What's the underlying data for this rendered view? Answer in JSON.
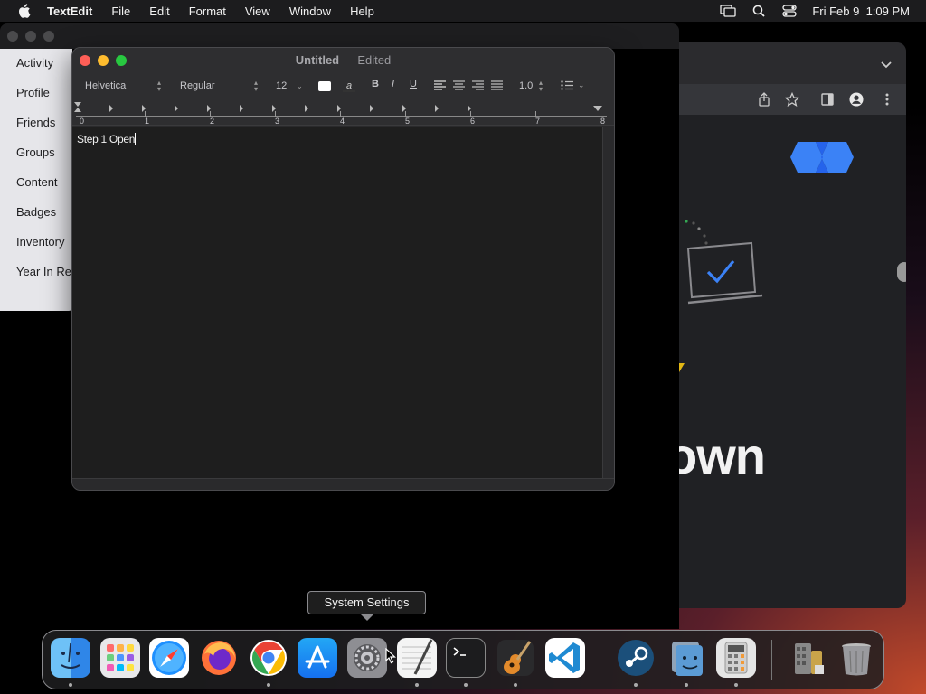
{
  "menubar": {
    "app_name": "TextEdit",
    "items": [
      "File",
      "Edit",
      "Format",
      "View",
      "Window",
      "Help"
    ],
    "clock": "Fri Feb 9  1:09 PM"
  },
  "sidebar": {
    "items": [
      "Activity",
      "Profile",
      "Friends",
      "Groups",
      "Content",
      "Badges",
      "Inventory",
      "Year In Re"
    ]
  },
  "browser": {
    "big_text": "own"
  },
  "textedit": {
    "title": "Untitled",
    "title_sep": "—",
    "status": "Edited",
    "font_family": "Helvetica",
    "font_style": "Regular",
    "font_size": "12",
    "bold": "B",
    "italic": "I",
    "underline": "U",
    "line_spacing": "1.0",
    "ruler_numbers": [
      "0",
      "1",
      "2",
      "3",
      "4",
      "5",
      "6",
      "7",
      "8"
    ],
    "document_text": "Step 1 Open"
  },
  "tooltip": {
    "text": "System Settings"
  },
  "dock": {
    "apps": [
      "finder-icon",
      "launchpad-icon",
      "safari-icon",
      "firefox-icon",
      "chrome-icon",
      "app-store-icon",
      "system-settings-icon",
      "textedit-icon",
      "terminal-icon",
      "garageband-icon",
      "vscode-icon",
      "steam-icon",
      "preview-finder-icon",
      "calculator-icon",
      "downloads-stack-icon",
      "trash-icon"
    ]
  },
  "colors": {
    "traffic_red": "#fe5f57",
    "traffic_yellow": "#febc2e",
    "traffic_green": "#28c840",
    "accent_blue": "#4285f4"
  }
}
